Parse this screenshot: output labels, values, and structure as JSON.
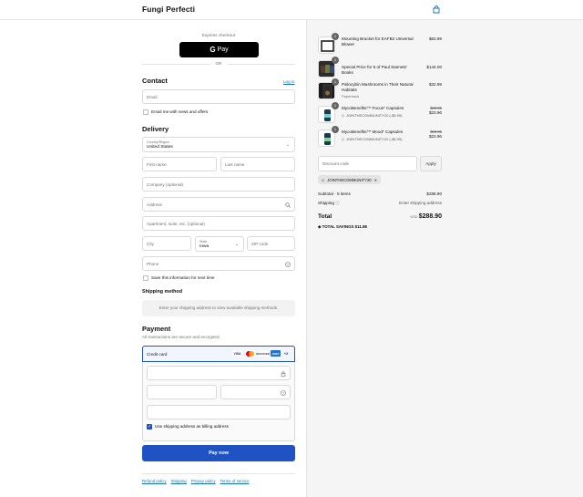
{
  "header": {
    "brand": "Fungi Perfecti",
    "cart_icon": "shopping-bag-icon"
  },
  "express": {
    "label": "Express checkout",
    "gpay_g": "G",
    "gpay_pay": "Pay",
    "or": "OR"
  },
  "contact": {
    "heading": "Contact",
    "login_link": "Log in",
    "email_placeholder": "Email",
    "news_label": "Email me with news and offers"
  },
  "delivery": {
    "heading": "Delivery",
    "country_label": "Country/Region",
    "country_value": "United States",
    "first_name": "First name",
    "last_name": "Last name",
    "company": "Company (optional)",
    "address": "Address",
    "apartment": "Apartment, suite, etc. (optional)",
    "city": "City",
    "state_label": "State",
    "state_value": "Iowa",
    "zip": "ZIP code",
    "phone": "Phone",
    "save_label": "Save this information for next time"
  },
  "shipping": {
    "heading": "Shipping method",
    "notice": "Enter your shipping address to view available shipping methods."
  },
  "payment": {
    "heading": "Payment",
    "subtext": "All transactions are secure and encrypted.",
    "method": "Credit card",
    "logos": {
      "visa": "VISA",
      "discover": "DISCOVER",
      "amex": "AMEX",
      "more": "+2"
    },
    "billing_label": "Use shipping address as billing address",
    "pay_button": "Pay now"
  },
  "footer": {
    "links": [
      "Refund policy",
      "Shipping",
      "Privacy policy",
      "Terms of service"
    ]
  },
  "cart": {
    "items": [
      {
        "qty": "1",
        "title": "Mounting Bracket for EAFB2 Universal Blower",
        "sub": "",
        "discount": "",
        "old_price": "",
        "price": "$63.99"
      },
      {
        "qty": "1",
        "title": "Special Price for 5 of Paul Stamets' Books",
        "sub": "",
        "discount": "",
        "old_price": "",
        "price": "$144.00"
      },
      {
        "qty": "1",
        "title": "Psilocybin Mushrooms in Their Natural Habitats",
        "sub": "Paperback",
        "discount": "",
        "old_price": "",
        "price": "$32.99"
      },
      {
        "qty": "1",
        "title": "MycoBenefits™ Focus* Capsules",
        "sub": "",
        "discount": "JOINTHECOMMUNITY20 (-$5.99)",
        "old_price": "$29.95",
        "price": "$23.96"
      },
      {
        "qty": "1",
        "title": "MycoBenefits™ Mood* Capsules",
        "sub": "",
        "discount": "JOINTHECOMMUNITY20 (-$5.99)",
        "old_price": "$29.95",
        "price": "$23.96"
      }
    ],
    "discount_placeholder": "Discount code",
    "apply": "Apply",
    "applied_code": "JOINTHECOMMUNITY20",
    "subtotal_label": "Subtotal · 5 items",
    "subtotal_value": "$288.90",
    "shipping_label": "Shipping",
    "shipping_value": "Enter shipping address",
    "total_label": "Total",
    "currency": "USD",
    "total_value": "$288.90",
    "savings_label": "TOTAL SAVINGS",
    "savings_value": "$11.98"
  },
  "colors": {
    "primary": "#1f53c4",
    "link": "#1773b0",
    "sidebar_bg": "#f5f5f5"
  }
}
